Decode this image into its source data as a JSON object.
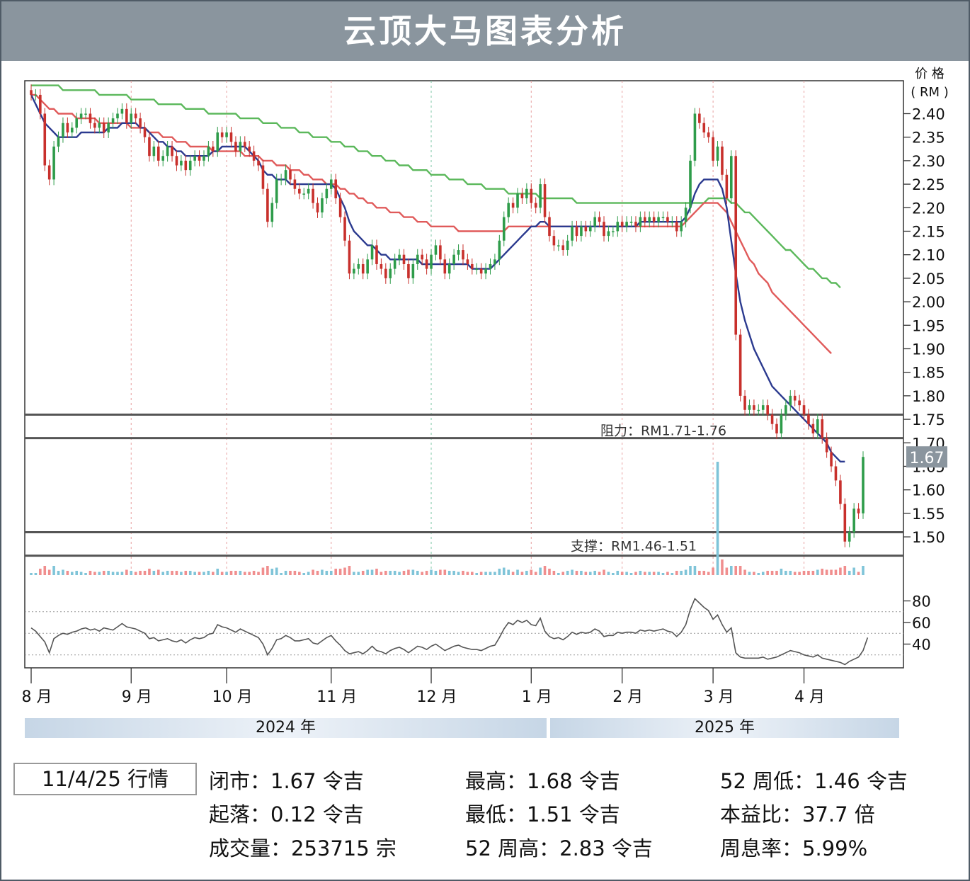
{
  "title": "云顶大马图表分析",
  "chart_data": {
    "type": "candlestick",
    "y_axis_title": [
      "价 格",
      "( RM )"
    ],
    "ylim": [
      1.47,
      2.47
    ],
    "yticks": [
      "2.40",
      "2.35",
      "2.30",
      "2.25",
      "2.20",
      "2.15",
      "2.10",
      "2.05",
      "2.00",
      "1.95",
      "1.90",
      "1.85",
      "1.80",
      "1.75",
      "1.70",
      "1.65",
      "1.60",
      "1.55",
      "1.50"
    ],
    "current_price_label": "1.67",
    "current_price": 1.67,
    "x_labels": [
      {
        "label": "8 月",
        "i": 0
      },
      {
        "label": "9 月",
        "i": 22
      },
      {
        "label": "10 月",
        "i": 43
      },
      {
        "label": "11 月",
        "i": 66
      },
      {
        "label": "12 月",
        "i": 88
      },
      {
        "label": "1 月",
        "i": 110
      },
      {
        "label": "2 月",
        "i": 130
      },
      {
        "label": "3 月",
        "i": 150
      },
      {
        "label": "4 月",
        "i": 170
      }
    ],
    "years": [
      "2024 年",
      "2025 年"
    ],
    "candles": [
      2.44,
      2.44,
      2.4,
      2.29,
      2.26,
      2.33,
      2.35,
      2.38,
      2.36,
      2.37,
      2.39,
      2.4,
      2.4,
      2.38,
      2.37,
      2.38,
      2.36,
      2.38,
      2.39,
      2.4,
      2.41,
      2.38,
      2.4,
      2.39,
      2.37,
      2.35,
      2.31,
      2.33,
      2.3,
      2.31,
      2.33,
      2.31,
      2.29,
      2.3,
      2.28,
      2.3,
      2.31,
      2.3,
      2.31,
      2.33,
      2.32,
      2.36,
      2.35,
      2.36,
      2.34,
      2.32,
      2.34,
      2.33,
      2.32,
      2.3,
      2.29,
      2.24,
      2.17,
      2.21,
      2.26,
      2.26,
      2.28,
      2.26,
      2.24,
      2.23,
      2.23,
      2.24,
      2.21,
      2.19,
      2.22,
      2.24,
      2.26,
      2.22,
      2.18,
      2.13,
      2.06,
      2.07,
      2.08,
      2.06,
      2.09,
      2.12,
      2.08,
      2.07,
      2.05,
      2.07,
      2.09,
      2.1,
      2.08,
      2.05,
      2.08,
      2.1,
      2.09,
      2.07,
      2.1,
      2.12,
      2.09,
      2.06,
      2.08,
      2.1,
      2.11,
      2.09,
      2.08,
      2.07,
      2.07,
      2.06,
      2.07,
      2.08,
      2.09,
      2.13,
      2.18,
      2.21,
      2.2,
      2.23,
      2.22,
      2.24,
      2.21,
      2.2,
      2.25,
      2.18,
      2.14,
      2.12,
      2.12,
      2.11,
      2.13,
      2.16,
      2.14,
      2.16,
      2.15,
      2.16,
      2.18,
      2.17,
      2.14,
      2.15,
      2.15,
      2.17,
      2.16,
      2.17,
      2.17,
      2.16,
      2.18,
      2.17,
      2.18,
      2.17,
      2.18,
      2.18,
      2.17,
      2.17,
      2.15,
      2.17,
      2.2,
      2.3,
      2.4,
      2.38,
      2.36,
      2.35,
      2.3,
      2.33,
      2.27,
      2.22,
      2.31,
      1.93,
      1.8,
      1.77,
      1.78,
      1.77,
      1.77,
      1.78,
      1.76,
      1.74,
      1.72,
      1.76,
      1.78,
      1.8,
      1.79,
      1.78,
      1.76,
      1.74,
      1.72,
      1.75,
      1.71,
      1.68,
      1.65,
      1.62,
      1.57,
      1.49,
      1.51,
      1.56,
      1.55,
      1.67
    ],
    "ma_short": [
      2.44,
      2.42,
      2.4,
      2.38,
      2.37,
      2.36,
      2.35,
      2.35,
      2.35,
      2.35,
      2.35,
      2.36,
      2.36,
      2.36,
      2.36,
      2.36,
      2.36,
      2.37,
      2.37,
      2.37,
      2.38,
      2.38,
      2.38,
      2.38,
      2.37,
      2.37,
      2.36,
      2.35,
      2.34,
      2.34,
      2.33,
      2.33,
      2.32,
      2.32,
      2.31,
      2.31,
      2.31,
      2.31,
      2.31,
      2.31,
      2.32,
      2.32,
      2.33,
      2.33,
      2.33,
      2.33,
      2.33,
      2.33,
      2.32,
      2.31,
      2.3,
      2.28,
      2.27,
      2.27,
      2.26,
      2.26,
      2.26,
      2.25,
      2.25,
      2.25,
      2.25,
      2.25,
      2.25,
      2.25,
      2.25,
      2.25,
      2.25,
      2.24,
      2.22,
      2.2,
      2.17,
      2.15,
      2.14,
      2.13,
      2.12,
      2.12,
      2.11,
      2.1,
      2.1,
      2.09,
      2.09,
      2.09,
      2.09,
      2.09,
      2.09,
      2.09,
      2.08,
      2.08,
      2.08,
      2.08,
      2.08,
      2.08,
      2.08,
      2.08,
      2.08,
      2.08,
      2.08,
      2.07,
      2.07,
      2.07,
      2.07,
      2.07,
      2.08,
      2.09,
      2.1,
      2.11,
      2.12,
      2.13,
      2.14,
      2.15,
      2.16,
      2.16,
      2.17,
      2.17,
      2.16,
      2.16,
      2.16,
      2.16,
      2.16,
      2.16,
      2.16,
      2.16,
      2.16,
      2.16,
      2.16,
      2.16,
      2.16,
      2.16,
      2.16,
      2.16,
      2.16,
      2.16,
      2.16,
      2.16,
      2.17,
      2.17,
      2.17,
      2.17,
      2.17,
      2.17,
      2.17,
      2.17,
      2.17,
      2.17,
      2.18,
      2.2,
      2.23,
      2.25,
      2.26,
      2.26,
      2.26,
      2.26,
      2.24,
      2.2,
      2.13,
      2.06,
      2.0,
      1.96,
      1.93,
      1.9,
      1.88,
      1.86,
      1.84,
      1.82,
      1.81,
      1.8,
      1.79,
      1.78,
      1.77,
      1.76,
      1.75,
      1.74,
      1.73,
      1.72,
      1.71,
      1.7,
      1.68,
      1.67,
      1.66,
      1.66
    ],
    "ma_mid": [
      2.44,
      2.44,
      2.43,
      2.42,
      2.41,
      2.41,
      2.4,
      2.4,
      2.4,
      2.4,
      2.39,
      2.39,
      2.39,
      2.39,
      2.39,
      2.38,
      2.38,
      2.38,
      2.38,
      2.38,
      2.38,
      2.38,
      2.37,
      2.37,
      2.37,
      2.37,
      2.36,
      2.36,
      2.36,
      2.35,
      2.35,
      2.35,
      2.34,
      2.34,
      2.34,
      2.33,
      2.33,
      2.33,
      2.33,
      2.33,
      2.32,
      2.32,
      2.32,
      2.32,
      2.32,
      2.32,
      2.32,
      2.31,
      2.31,
      2.31,
      2.31,
      2.3,
      2.3,
      2.3,
      2.29,
      2.29,
      2.29,
      2.28,
      2.28,
      2.28,
      2.27,
      2.27,
      2.26,
      2.26,
      2.26,
      2.25,
      2.25,
      2.25,
      2.24,
      2.24,
      2.23,
      2.23,
      2.22,
      2.22,
      2.21,
      2.21,
      2.2,
      2.2,
      2.2,
      2.19,
      2.19,
      2.19,
      2.18,
      2.18,
      2.18,
      2.17,
      2.17,
      2.17,
      2.16,
      2.16,
      2.16,
      2.16,
      2.16,
      2.16,
      2.15,
      2.15,
      2.15,
      2.15,
      2.15,
      2.15,
      2.15,
      2.15,
      2.15,
      2.15,
      2.15,
      2.16,
      2.16,
      2.16,
      2.16,
      2.16,
      2.16,
      2.16,
      2.16,
      2.16,
      2.16,
      2.16,
      2.16,
      2.16,
      2.16,
      2.16,
      2.16,
      2.16,
      2.16,
      2.16,
      2.16,
      2.16,
      2.16,
      2.16,
      2.16,
      2.16,
      2.16,
      2.16,
      2.16,
      2.16,
      2.16,
      2.16,
      2.16,
      2.16,
      2.16,
      2.16,
      2.16,
      2.16,
      2.16,
      2.16,
      2.17,
      2.18,
      2.19,
      2.2,
      2.21,
      2.21,
      2.21,
      2.21,
      2.2,
      2.19,
      2.17,
      2.15,
      2.13,
      2.11,
      2.09,
      2.08,
      2.06,
      2.05,
      2.04,
      2.02,
      2.01,
      2.0,
      1.99,
      1.98,
      1.97,
      1.96,
      1.95,
      1.94,
      1.93,
      1.92,
      1.91,
      1.9,
      1.89
    ],
    "ma_long": [
      2.46,
      2.46,
      2.46,
      2.46,
      2.46,
      2.46,
      2.46,
      2.45,
      2.45,
      2.45,
      2.45,
      2.45,
      2.45,
      2.45,
      2.45,
      2.44,
      2.44,
      2.44,
      2.44,
      2.44,
      2.44,
      2.44,
      2.43,
      2.43,
      2.43,
      2.43,
      2.43,
      2.43,
      2.42,
      2.42,
      2.42,
      2.42,
      2.42,
      2.42,
      2.41,
      2.41,
      2.41,
      2.41,
      2.41,
      2.4,
      2.4,
      2.4,
      2.4,
      2.4,
      2.4,
      2.4,
      2.39,
      2.39,
      2.39,
      2.39,
      2.39,
      2.38,
      2.38,
      2.38,
      2.38,
      2.37,
      2.37,
      2.37,
      2.37,
      2.36,
      2.36,
      2.36,
      2.35,
      2.35,
      2.35,
      2.35,
      2.34,
      2.34,
      2.34,
      2.33,
      2.33,
      2.33,
      2.32,
      2.32,
      2.32,
      2.31,
      2.31,
      2.31,
      2.3,
      2.3,
      2.3,
      2.29,
      2.29,
      2.29,
      2.28,
      2.28,
      2.28,
      2.28,
      2.27,
      2.27,
      2.27,
      2.27,
      2.26,
      2.26,
      2.26,
      2.26,
      2.25,
      2.25,
      2.25,
      2.25,
      2.24,
      2.24,
      2.24,
      2.24,
      2.24,
      2.23,
      2.23,
      2.23,
      2.23,
      2.23,
      2.23,
      2.23,
      2.22,
      2.22,
      2.22,
      2.22,
      2.22,
      2.22,
      2.22,
      2.22,
      2.21,
      2.21,
      2.21,
      2.21,
      2.21,
      2.21,
      2.21,
      2.21,
      2.21,
      2.21,
      2.21,
      2.21,
      2.21,
      2.21,
      2.21,
      2.21,
      2.21,
      2.21,
      2.21,
      2.21,
      2.21,
      2.21,
      2.21,
      2.21,
      2.21,
      2.21,
      2.21,
      2.21,
      2.21,
      2.22,
      2.22,
      2.22,
      2.22,
      2.22,
      2.21,
      2.21,
      2.2,
      2.19,
      2.19,
      2.18,
      2.17,
      2.16,
      2.15,
      2.14,
      2.13,
      2.12,
      2.11,
      2.11,
      2.1,
      2.09,
      2.08,
      2.07,
      2.07,
      2.06,
      2.05,
      2.05,
      2.04,
      2.04,
      2.03
    ],
    "resistance": {
      "label": "阻力：RM1.71-1.76",
      "low": 1.71,
      "high": 1.76
    },
    "support": {
      "label": "支撑：RM1.46-1.51",
      "low": 1.46,
      "high": 1.51
    },
    "oscillator": {
      "ylim": [
        18,
        100
      ],
      "yticks": [
        "80",
        "60",
        "40"
      ],
      "levels": [
        30,
        50,
        70
      ],
      "values": [
        55,
        52,
        47,
        42,
        32,
        45,
        48,
        50,
        49,
        51,
        52,
        54,
        55,
        53,
        54,
        52,
        55,
        54,
        53,
        56,
        59,
        56,
        55,
        54,
        52,
        50,
        45,
        46,
        43,
        44,
        45,
        43,
        42,
        44,
        41,
        44,
        46,
        45,
        46,
        49,
        50,
        58,
        56,
        55,
        53,
        51,
        54,
        52,
        50,
        48,
        46,
        40,
        30,
        36,
        44,
        45,
        48,
        46,
        43,
        43,
        44,
        45,
        41,
        40,
        43,
        46,
        48,
        43,
        39,
        34,
        31,
        32,
        33,
        31,
        34,
        38,
        34,
        33,
        31,
        34,
        36,
        37,
        35,
        32,
        35,
        38,
        37,
        35,
        38,
        40,
        37,
        34,
        36,
        38,
        39,
        37,
        36,
        35,
        35,
        34,
        36,
        38,
        39,
        46,
        54,
        60,
        58,
        62,
        60,
        62,
        58,
        57,
        64,
        52,
        47,
        45,
        46,
        44,
        47,
        51,
        49,
        51,
        50,
        51,
        54,
        52,
        47,
        48,
        48,
        51,
        50,
        51,
        51,
        50,
        53,
        52,
        53,
        52,
        53,
        54,
        52,
        51,
        47,
        51,
        58,
        72,
        82,
        78,
        74,
        71,
        63,
        67,
        58,
        51,
        55,
        32,
        28,
        27,
        27,
        27,
        27,
        28,
        26,
        27,
        28,
        30,
        32,
        34,
        33,
        32,
        30,
        29,
        28,
        30,
        27,
        26,
        25,
        24,
        23,
        21,
        24,
        26,
        28,
        34,
        46
      ]
    }
  },
  "stats": {
    "date_label": "11/4/25 行情",
    "close": "闭市：1.67 令吉",
    "change": "起落：0.12 令吉",
    "volume": "成交量：253715 宗",
    "high": "最高：1.68 令吉",
    "low": "最低：1.51 令吉",
    "high52": "52 周高：2.83 令吉",
    "low52": "52 周低：1.46 令吉",
    "pe": "本益比：37.7 倍",
    "yield": "周息率：5.99%"
  },
  "colors": {
    "up": "#2e9c4a",
    "down": "#c8302c",
    "ma_short": "#2b3a8f",
    "ma_mid": "#e05a5a",
    "ma_long": "#5bb85b",
    "osc": "#555555",
    "band": "#555555"
  }
}
